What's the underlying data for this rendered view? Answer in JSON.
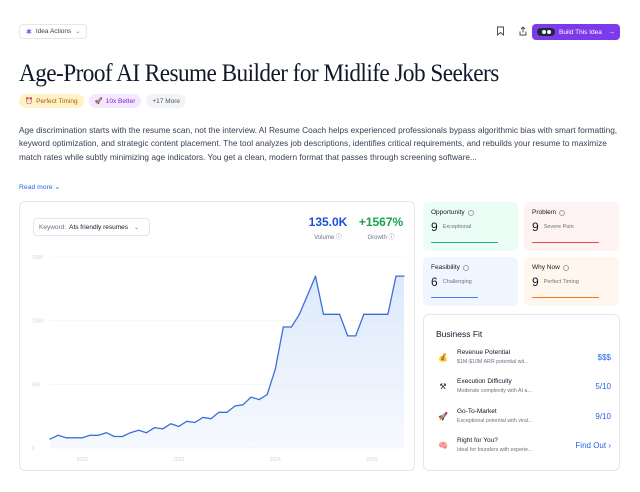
{
  "toolbar": {
    "idea_actions": "Idea Actions",
    "build_label": "Build This Idea"
  },
  "title": "Age-Proof AI Resume Builder for Midlife Job Seekers",
  "tags": [
    "Perfect Timing",
    "10x Better",
    "+17 More"
  ],
  "description": "Age discrimination starts with the resume scan, not the interview. AI Resume Coach helps experienced professionals bypass algorithmic bias with smart formatting, keyword optimization, and strategic content placement. The tool analyzes job descriptions, identifies critical requirements, and rebuilds your resume to maximize match rates while subtly minimizing age indicators. You get a clean, modern format that passes through screening software...",
  "read_more": "Read more",
  "keyword": {
    "label": "Keyword:",
    "value": "Ats friendly resumes"
  },
  "stats": {
    "volume": {
      "value": "135.0K",
      "label": "Volume"
    },
    "growth": {
      "value": "+1567%",
      "label": "Growth"
    }
  },
  "metrics": {
    "opportunity": {
      "label": "Opportunity",
      "value": "9",
      "sub": "Exceptional"
    },
    "problem": {
      "label": "Problem",
      "value": "9",
      "sub": "Severe Pain"
    },
    "feasibility": {
      "label": "Feasibility",
      "value": "6",
      "sub": "Challenging"
    },
    "why_now": {
      "label": "Why Now",
      "value": "9",
      "sub": "Perfect Timing"
    }
  },
  "business_fit": {
    "title": "Business Fit",
    "items": [
      {
        "name": "Revenue Potential",
        "sub": "$1M-$10M ARR potential wit...",
        "value": "$$$"
      },
      {
        "name": "Execution Difficulty",
        "sub": "Moderate complexity with AI a...",
        "value": "5/10"
      },
      {
        "name": "Go-To-Market",
        "sub": "Exceptional potential with viral...",
        "value": "9/10"
      },
      {
        "name": "Right for You?",
        "sub": "Ideal for founders with experie...",
        "value": "Find Out"
      }
    ]
  },
  "colors": {
    "accent": "#7c3aed",
    "line": "#3b6fd8",
    "area": "#dbe8fb"
  },
  "chart_data": {
    "type": "area",
    "ylim": [
      0,
      150000
    ],
    "yticks": [
      "0",
      "50K",
      "100K",
      "150K"
    ],
    "xticks": [
      "2022",
      "2023",
      "2024",
      "2025"
    ],
    "x": [
      "2021-09",
      "2021-10",
      "2021-11",
      "2021-12",
      "2022-01",
      "2022-02",
      "2022-03",
      "2022-04",
      "2022-05",
      "2022-06",
      "2022-07",
      "2022-08",
      "2022-09",
      "2022-10",
      "2022-11",
      "2022-12",
      "2023-01",
      "2023-02",
      "2023-03",
      "2023-04",
      "2023-05",
      "2023-06",
      "2023-07",
      "2023-08",
      "2023-09",
      "2023-10",
      "2023-11",
      "2023-12",
      "2024-01",
      "2024-02",
      "2024-03",
      "2024-04",
      "2024-05",
      "2024-06",
      "2024-07",
      "2024-08",
      "2024-09",
      "2024-10",
      "2024-11",
      "2024-12",
      "2025-01",
      "2025-02",
      "2025-03",
      "2025-04",
      "2025-05"
    ],
    "values": [
      7000,
      10000,
      8000,
      8000,
      8000,
      10000,
      10000,
      12000,
      9000,
      9000,
      12000,
      14000,
      12000,
      16000,
      15000,
      19000,
      17000,
      21000,
      20000,
      24000,
      23000,
      28000,
      28000,
      33000,
      34000,
      40000,
      38000,
      42000,
      62000,
      95000,
      95000,
      105000,
      120000,
      135000,
      105000,
      105000,
      105000,
      88000,
      88000,
      105000,
      105000,
      105000,
      105000,
      135000,
      135000
    ]
  }
}
